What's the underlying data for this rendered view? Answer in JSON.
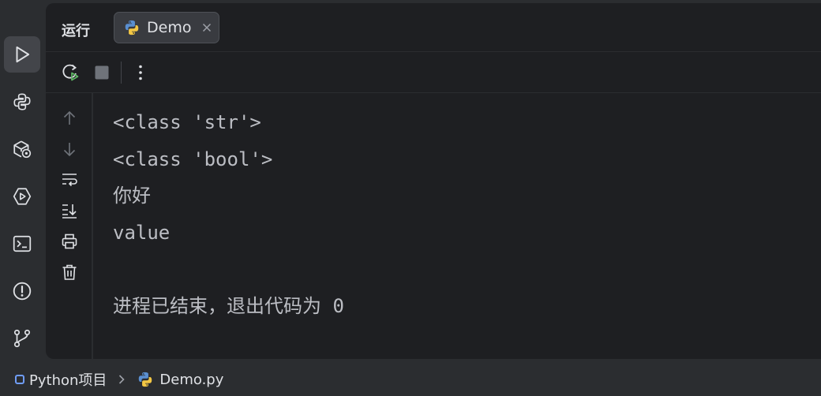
{
  "strip": {
    "items": [
      {
        "icon": "run-icon",
        "active": true
      },
      {
        "icon": "python-packages-icon",
        "active": false
      },
      {
        "icon": "services-icon",
        "active": false
      },
      {
        "icon": "run-dashboard-icon",
        "active": false
      },
      {
        "icon": "terminal-icon",
        "active": false
      },
      {
        "icon": "problems-icon",
        "active": false
      },
      {
        "icon": "git-icon",
        "active": false
      }
    ]
  },
  "run_window": {
    "title": "运行",
    "tab": {
      "label": "Demo"
    }
  },
  "console": {
    "lines": [
      "<class 'str'>",
      "<class 'bool'>",
      "你好",
      "value",
      "",
      "进程已结束，退出代码为 0"
    ]
  },
  "breadcrumb": {
    "project": "Python项目",
    "file": "Demo.py"
  },
  "colors": {
    "background": "#1e1f22",
    "chrome": "#2b2d30",
    "accent_green": "#5fb865",
    "text": "#bcbec4"
  }
}
